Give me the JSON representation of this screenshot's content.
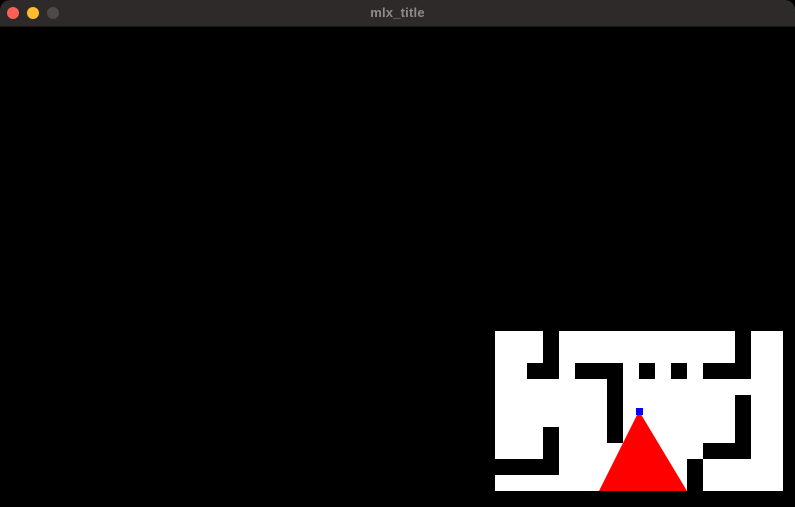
{
  "window": {
    "title": "mlx_title",
    "controls": [
      {
        "name": "close",
        "color": "#fe5f57"
      },
      {
        "name": "minimize",
        "color": "#febc2e"
      },
      {
        "name": "zoom",
        "color": "#4d4a48"
      }
    ]
  },
  "game": {
    "background_color": "#000000",
    "minimap": {
      "floor_color": "#ffffff",
      "wall_color": "#000000",
      "player_color": "#0000ff",
      "view_cone_color": "#ff0000"
    }
  }
}
